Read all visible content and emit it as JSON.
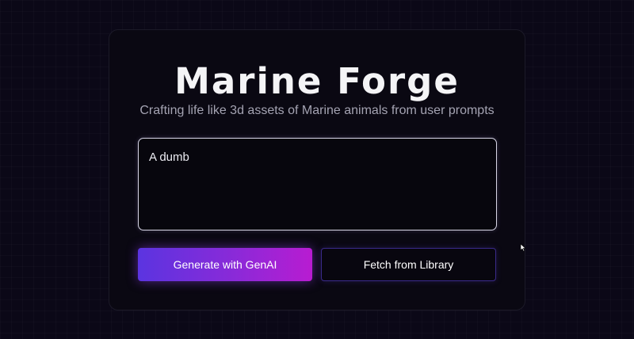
{
  "app": {
    "title": "Marine Forge",
    "subtitle": "Crafting life like 3d assets of Marine animals from user prompts"
  },
  "prompt": {
    "value": "A dumb",
    "placeholder": ""
  },
  "actions": {
    "generate_label": "Generate with GenAI",
    "fetch_label": "Fetch from Library"
  },
  "icons": {
    "pointer": "mouse-pointer-icon"
  },
  "colors": {
    "background": "#0b0817",
    "card": "#0a0812",
    "accent_start": "#5b34e0",
    "accent_end": "#b81cd1",
    "fetch_border": "#3a2a8a"
  }
}
